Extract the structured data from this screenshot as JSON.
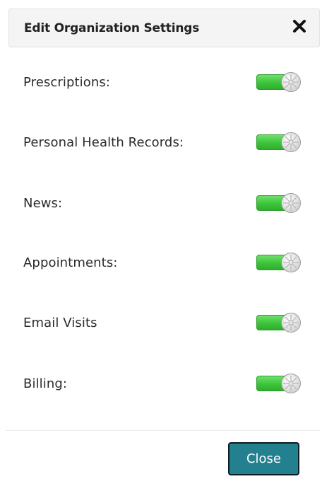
{
  "dialog": {
    "title": "Edit Organization Settings",
    "close_icon": "close-icon",
    "close_button_label": "Close"
  },
  "settings": [
    {
      "label": "Prescriptions:",
      "enabled": true
    },
    {
      "label": "Personal Health Records:",
      "enabled": true
    },
    {
      "label": "News:",
      "enabled": true
    },
    {
      "label": "Appointments:",
      "enabled": true
    },
    {
      "label": "Email Visits",
      "enabled": true
    },
    {
      "label": "Billing:",
      "enabled": true
    }
  ],
  "colors": {
    "toggle_on": "#3cc43a",
    "button_bg": "#22808f",
    "header_bg": "#f4f4f4"
  }
}
